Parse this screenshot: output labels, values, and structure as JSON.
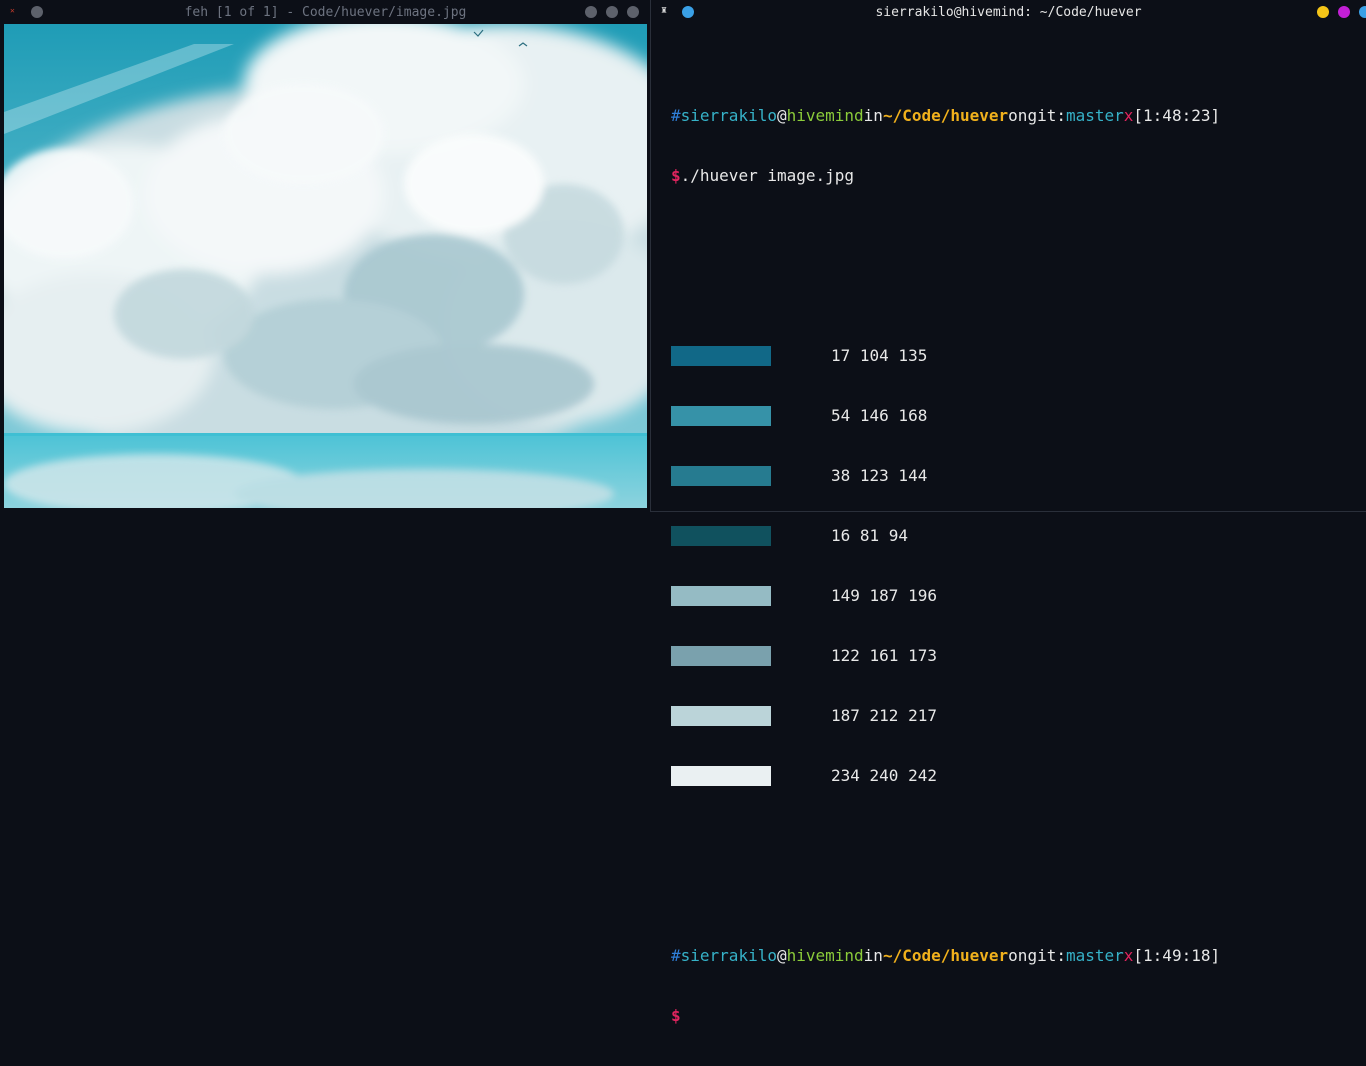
{
  "feh": {
    "title": "feh [1 of 1] - Code/huever/image.jpg"
  },
  "terminal": {
    "title": "sierrakilo@hivemind: ~/Code/huever",
    "prompt1": {
      "hash": "#",
      "user": "sierrakilo",
      "at": "@",
      "host": "hivemind",
      "in": "in",
      "path": "~/Code/huever",
      "on": "on",
      "git": "git:",
      "branch": "master",
      "dirty": "x",
      "time": "[1:48:23]"
    },
    "command": {
      "dollar": "$",
      "text": "./huever image.jpg"
    },
    "palette": [
      {
        "rgb": "17 104 135",
        "color": "#116887"
      },
      {
        "rgb": "54 146 168",
        "color": "#3692a8"
      },
      {
        "rgb": "38 123 144",
        "color": "#267b90"
      },
      {
        "rgb": "16 81 94",
        "color": "#10515e"
      },
      {
        "rgb": "149 187 196",
        "color": "#95bbc4"
      },
      {
        "rgb": "122 161 173",
        "color": "#7aa1ad"
      },
      {
        "rgb": "187 212 217",
        "color": "#bbd4d9"
      },
      {
        "rgb": "234 240 242",
        "color": "#eaf0f2"
      }
    ],
    "prompt2": {
      "hash": "#",
      "user": "sierrakilo",
      "at": "@",
      "host": "hivemind",
      "in": "in",
      "path": "~/Code/huever",
      "on": "on",
      "git": "git:",
      "branch": "master",
      "dirty": "x",
      "time": "[1:49:18]"
    },
    "cursor_prompt": "$"
  },
  "colors": {
    "desktop": "#0c0f17",
    "window_btn_gray": "#5d616b",
    "btn_yellow": "#f5c518",
    "btn_magenta": "#c31fd6",
    "btn_blue": "#3aa0e6"
  },
  "icons": {
    "feh_app": "feh-icon",
    "term_app": "terminal-app-icon"
  }
}
